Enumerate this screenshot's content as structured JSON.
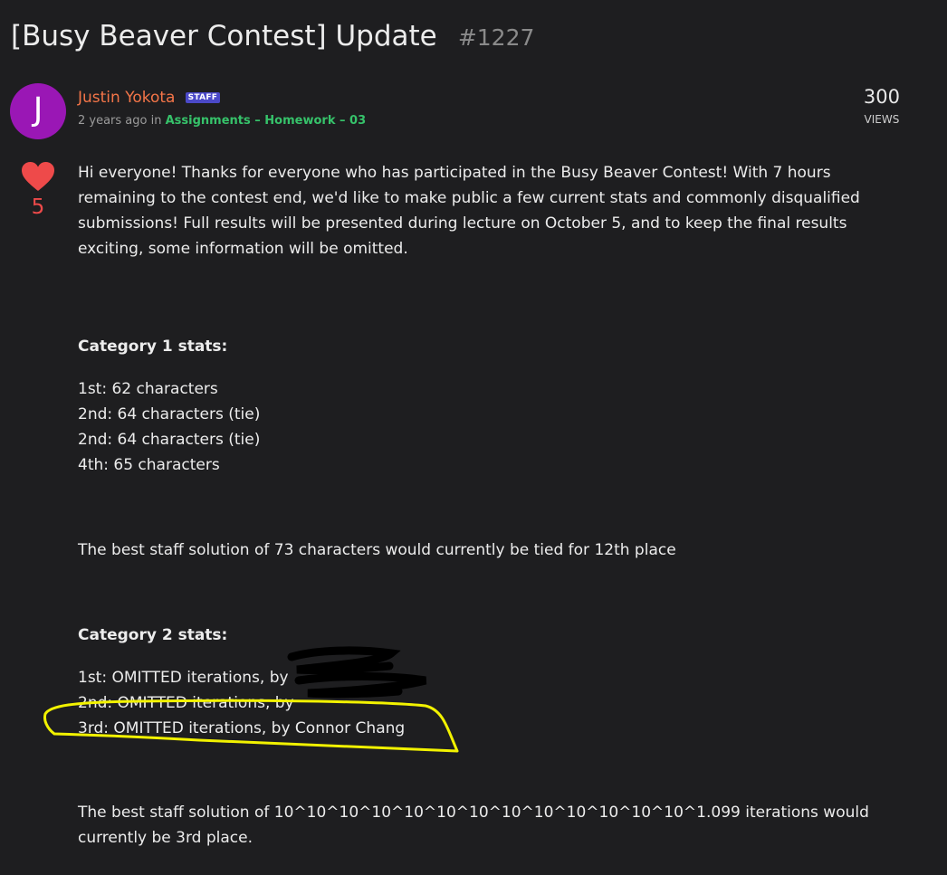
{
  "post": {
    "title": "[Busy Beaver Contest] Update",
    "number": "#1227"
  },
  "author": {
    "initial": "J",
    "name": "Justin Yokota",
    "badge": "STAFF",
    "time": "2 years ago",
    "in_label": "in",
    "category": "Assignments – Homework – 03"
  },
  "stats": {
    "views_count": "300",
    "views_label": "VIEWS",
    "likes": "5"
  },
  "content": {
    "intro": "Hi everyone! Thanks for everyone who has participated in the Busy Beaver Contest! With 7 hours remaining to the contest end, we'd like to make public a few current stats and commonly disqualified submissions! Full results will be presented during lecture on October 5, and to keep the final results exciting, some information will be omitted.",
    "cat1_heading": "Category 1 stats:",
    "cat1_items": [
      "1st: 62 characters",
      "2nd: 64 characters (tie)",
      "2nd: 64 characters (tie)",
      "4th: 65 characters"
    ],
    "cat1_note": "The best staff solution of 73 characters would currently be tied for 12th place",
    "cat2_heading": "Category 2 stats:",
    "cat2_items": [
      "1st: OMITTED iterations, by",
      "2nd: OMITTED iterations, by",
      "3rd: OMITTED iterations, by Connor Chang"
    ],
    "cat2_note": "The best staff solution of 10^10^10^10^10^10^10^10^10^10^10^10^10^1.099 iterations would currently be 3rd place."
  },
  "colors": {
    "background": "#1e1e20",
    "author": "#f47548",
    "category_link": "#36c26a",
    "like": "#ee4a4a",
    "avatar": "#9a17b5",
    "highlight": "#f2f200"
  }
}
